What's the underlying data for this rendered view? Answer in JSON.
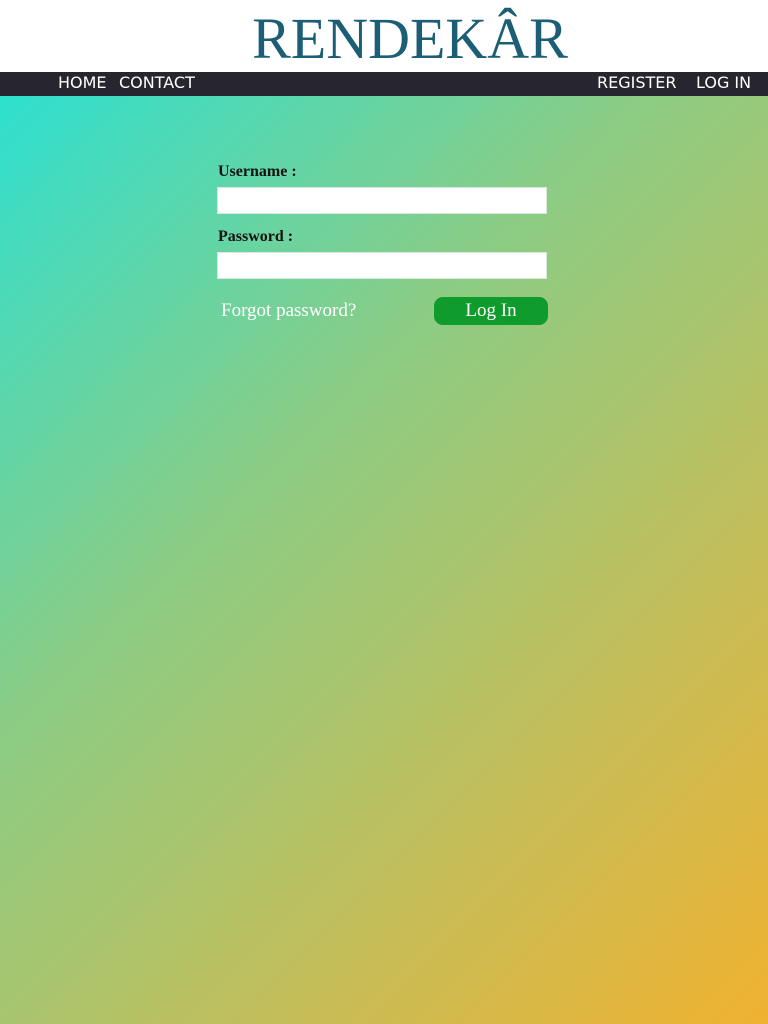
{
  "header": {
    "brand": "RENDEKÂR"
  },
  "nav": {
    "left": [
      "HOME",
      "CONTACT"
    ],
    "right": [
      "REGISTER",
      "LOG IN"
    ]
  },
  "login_form": {
    "username_label": "Username :",
    "username_value": "",
    "password_label": "Password :",
    "password_value": "",
    "forgot_link": "Forgot password?",
    "submit_label": "Log In"
  },
  "colors": {
    "brand": "#1b5e75",
    "navbar": "#27262e",
    "button": "#0f9c2c",
    "gradient_start": "#2ee0d0",
    "gradient_end": "#f0b230"
  }
}
